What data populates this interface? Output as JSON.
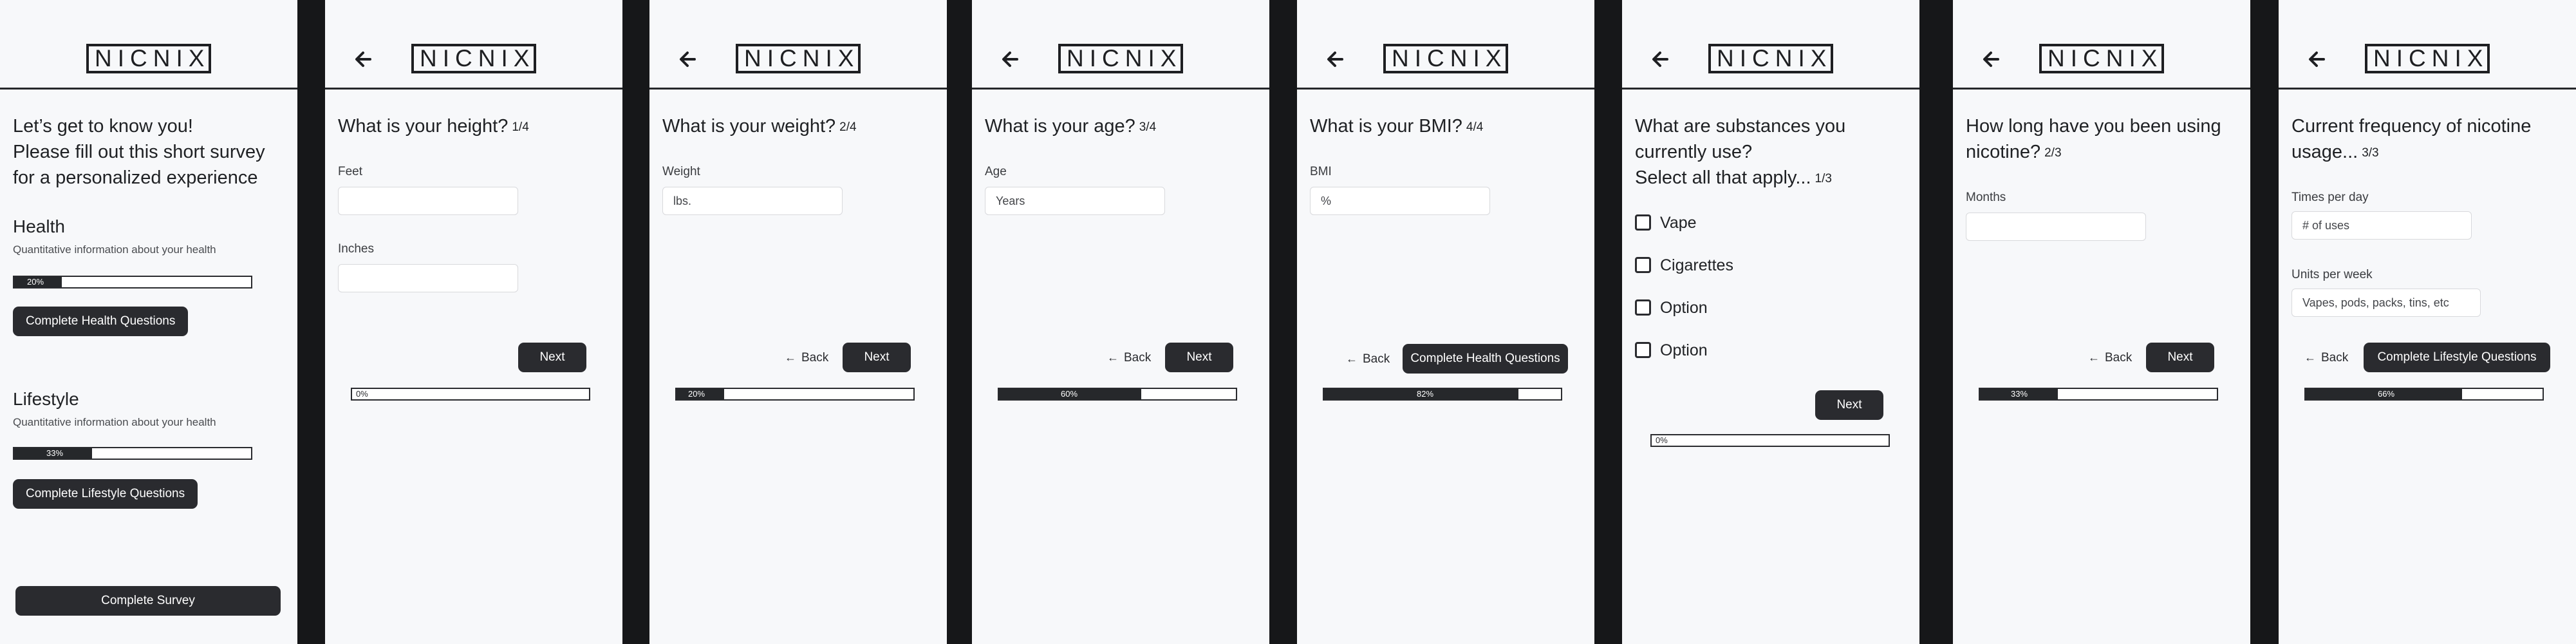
{
  "brand": {
    "logo_text": "NICNIX"
  },
  "intro": {
    "heading_lines": [
      "Let’s get to know you!",
      "Please fill out this short survey",
      "for a personalized experience"
    ],
    "health": {
      "title": "Health",
      "subtitle": "Quantitative information about your health",
      "progress_label": "20%",
      "progress": 0.2,
      "button": "Complete Health Questions"
    },
    "lifestyle": {
      "title": "Lifestyle",
      "subtitle": "Quantitative information about your health",
      "progress_label": "33%",
      "progress": 0.33,
      "button": "Complete Lifestyle Questions"
    },
    "complete_button": "Complete Survey"
  },
  "height": {
    "question": "What is your height?",
    "counter": "1/4",
    "feet_label": "Feet",
    "inches_label": "Inches",
    "next": "Next",
    "progress_label": "0%",
    "progress": 0
  },
  "weight": {
    "question": "What is your weight?",
    "counter": "2/4",
    "field_label": "Weight",
    "placeholder": "lbs.",
    "back": "Back",
    "next": "Next",
    "progress_label": "20%",
    "progress": 0.2
  },
  "age": {
    "question": "What is your age?",
    "counter": "3/4",
    "field_label": "Age",
    "placeholder": "Years",
    "back": "Back",
    "next": "Next",
    "progress_label": "60%",
    "progress": 0.6
  },
  "bmi": {
    "question": "What is your BMI?",
    "counter": "4/4",
    "field_label": "BMI",
    "placeholder": "%",
    "back": "Back",
    "next": "Complete Health Questions",
    "progress_label": "82%",
    "progress": 0.82
  },
  "substances": {
    "question_lines": [
      "What are substances you",
      "currently use?",
      "Select all that apply..."
    ],
    "counter": "1/3",
    "options": [
      "Vape",
      "Cigarettes",
      "Option",
      "Option"
    ],
    "next": "Next",
    "progress_label": "0%",
    "progress": 0
  },
  "duration": {
    "question_lines": [
      "How long have you been using",
      "nicotine?"
    ],
    "counter": "2/3",
    "field_label": "Months",
    "back": "Back",
    "next": "Next",
    "progress_label": "33%",
    "progress": 0.33
  },
  "frequency": {
    "question_lines": [
      "Current frequency of nicotine",
      "usage..."
    ],
    "counter": "3/3",
    "times_label": "Times per day",
    "times_placeholder": "# of uses",
    "units_label": "Units per week",
    "units_placeholder": "Vapes, pods, packs, tins, etc",
    "back": "Back",
    "next": "Complete Lifestyle Questions",
    "progress_label": "66%",
    "progress": 0.66
  }
}
